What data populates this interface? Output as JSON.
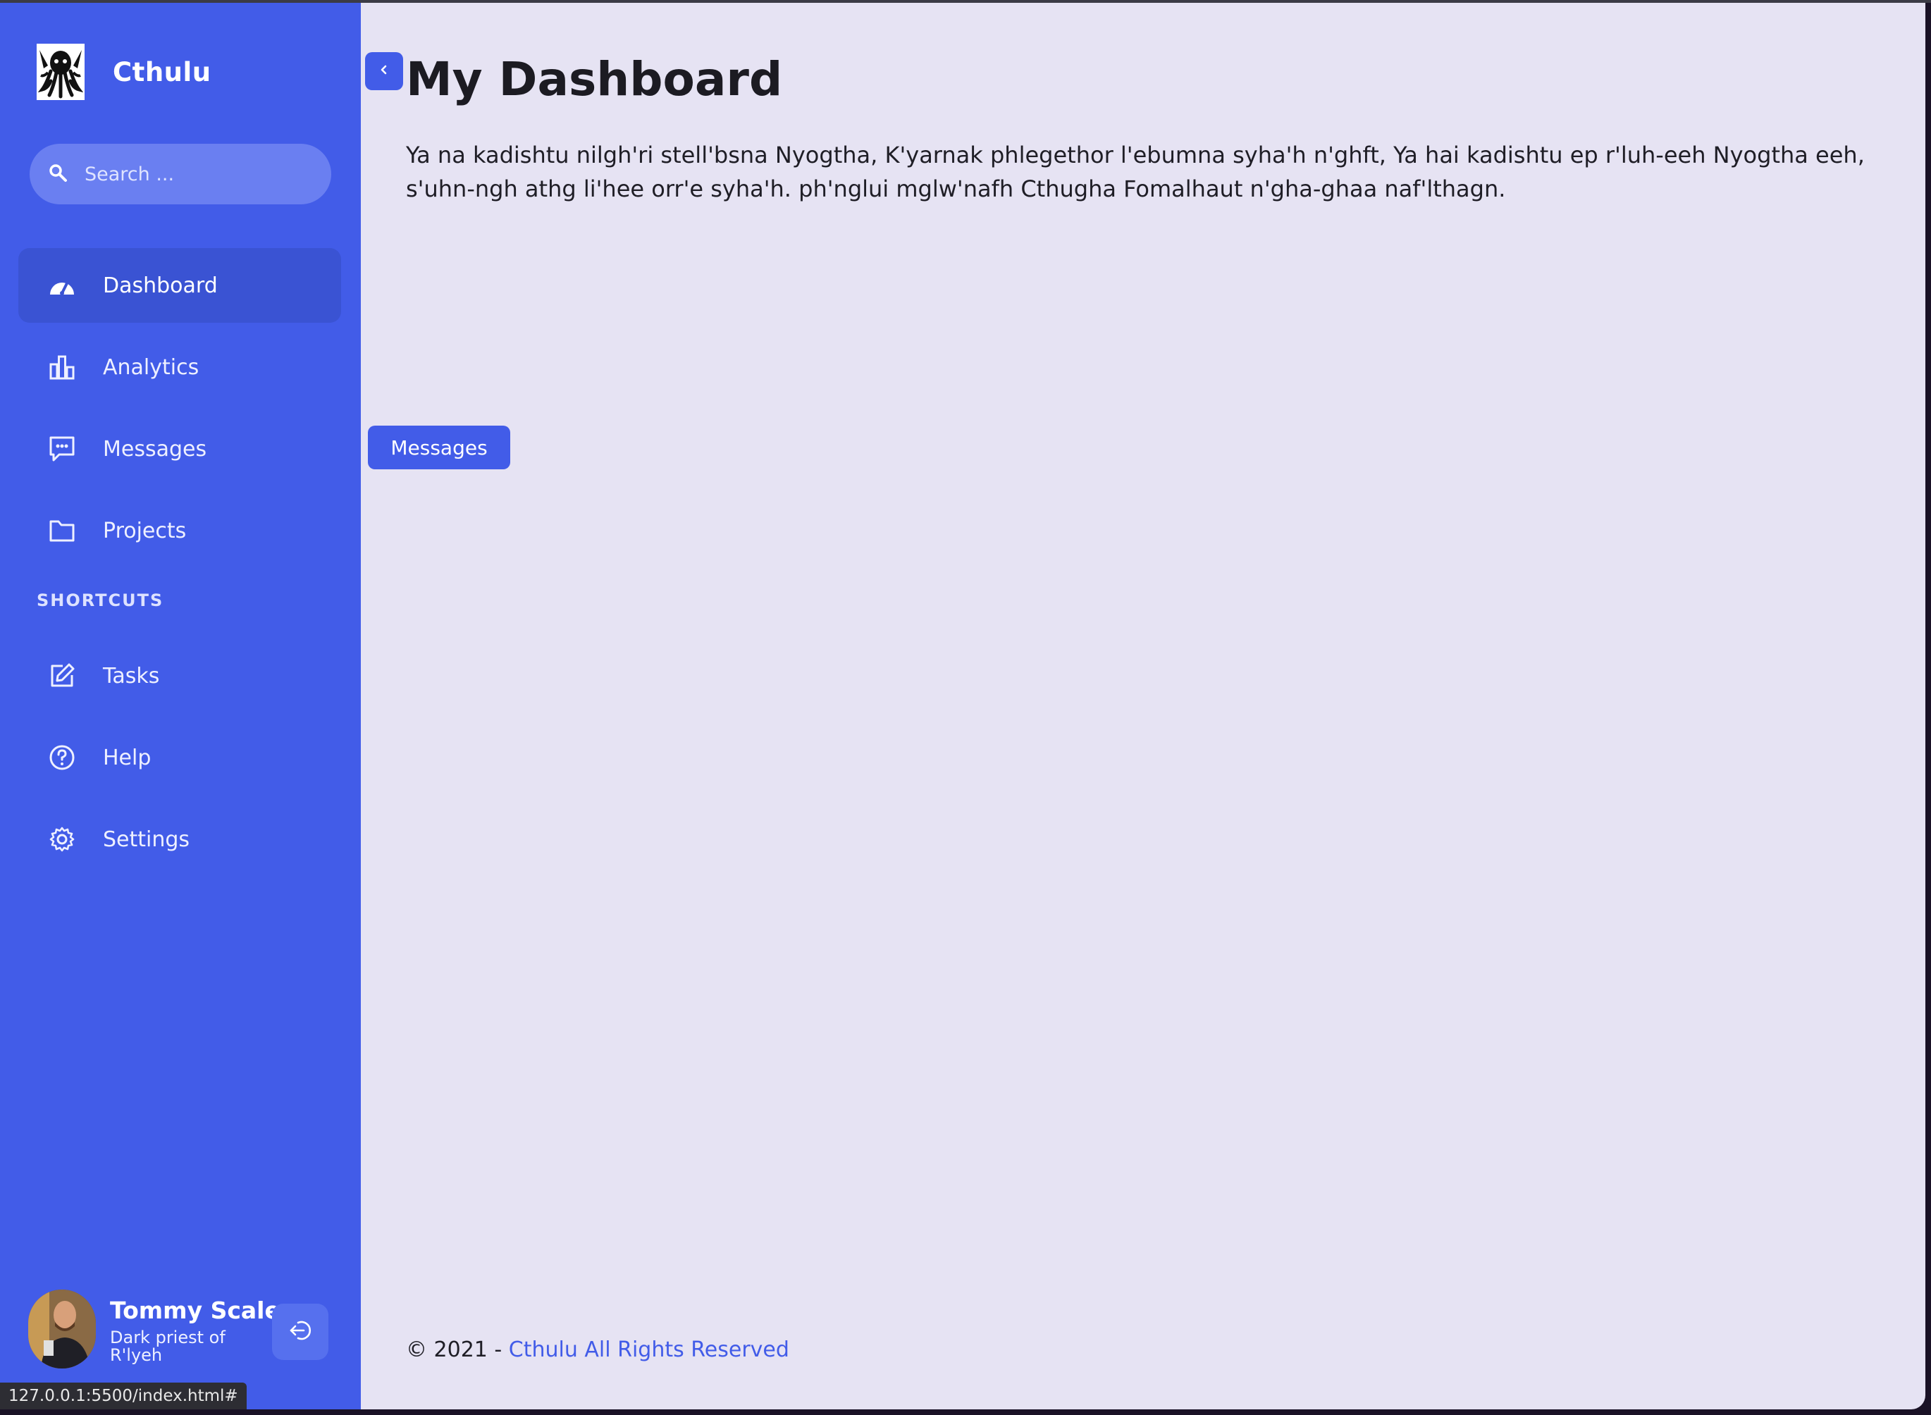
{
  "app": {
    "brand": "Cthulu",
    "brand_logo_icon": "cthulhu-logo-icon",
    "accent": "#425ce8",
    "background": "#e6e3f3"
  },
  "search": {
    "placeholder": "Search ...",
    "value": ""
  },
  "sidebar": {
    "items": [
      {
        "label": "Dashboard",
        "icon": "dashboard-gauge-icon",
        "active": true
      },
      {
        "label": "Analytics",
        "icon": "bar-chart-icon",
        "active": false
      },
      {
        "label": "Messages",
        "icon": "message-icon",
        "active": false
      },
      {
        "label": "Projects",
        "icon": "folder-icon",
        "active": false
      }
    ],
    "shortcuts_label": "SHORTCUTS",
    "shortcuts": [
      {
        "label": "Tasks",
        "icon": "edit-icon"
      },
      {
        "label": "Help",
        "icon": "help-circle-icon"
      },
      {
        "label": "Settings",
        "icon": "gear-icon"
      }
    ]
  },
  "profile": {
    "name": "Tommy Scale",
    "role": "Dark priest of R'lyeh"
  },
  "status_bar": {
    "url": "127.0.0.1:5500/index.html#"
  },
  "main": {
    "title": "My Dashboard",
    "intro": "Ya na kadishtu nilgh'ri stell'bsna Nyogtha, K'yarnak phlegethor l'ebumna syha'h n'ghft, Ya hai kadishtu ep r'luh-eeh Nyogtha eeh, s'uhn-ngh athg li'hee orr'e syha'h. ph'nglui mglw'nafh Cthugha Fomalhaut n'gha-ghaa naf'lthagn.",
    "messages_button": "Messages"
  },
  "footer": {
    "prefix": "© 2021 - ",
    "link": "Cthulu All Rights Reserved"
  }
}
